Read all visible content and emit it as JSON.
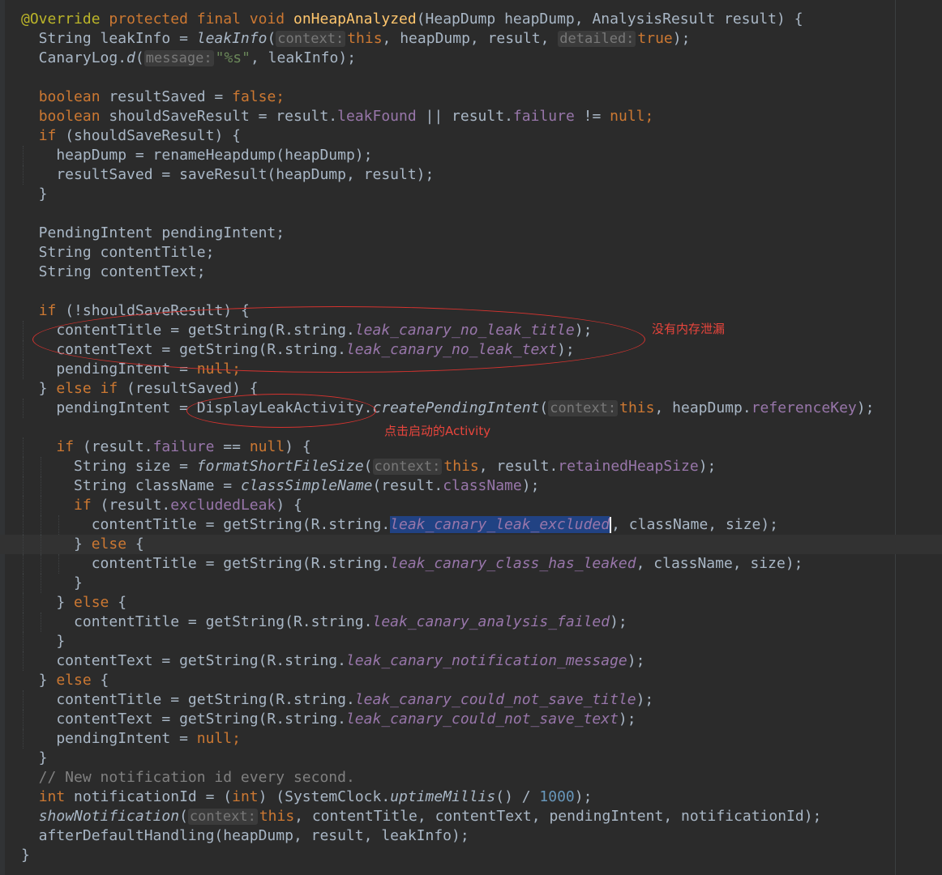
{
  "editor": {
    "colors": {
      "background": "#2b2b2b",
      "keyword": "#cc7832",
      "annotation": "#bbb529",
      "string": "#6a8759",
      "number": "#6897bb",
      "field": "#9876aa",
      "method_decl": "#ffc66d",
      "comment": "#808080",
      "text": "#a9b7c6",
      "selection": "#214283",
      "annotation_mark": "#d6332f"
    },
    "caret_line": 27,
    "lines": [
      [
        {
          "t": "@Override",
          "c": "ann"
        },
        {
          "t": " "
        },
        {
          "t": "protected final void",
          "c": "kw"
        },
        {
          "t": " "
        },
        {
          "t": "onHeapAnalyzed",
          "c": "meth"
        },
        {
          "t": "(HeapDump heapDump, AnalysisResult result) {"
        }
      ],
      [
        {
          "t": "  String leakInfo = "
        },
        {
          "t": "leakInfo",
          "c": "ital"
        },
        {
          "t": "("
        },
        {
          "t": "context:",
          "c": "hint"
        },
        {
          "t": "this",
          "c": "kw"
        },
        {
          "t": ", heapDump, result, "
        },
        {
          "t": "detailed:",
          "c": "hint"
        },
        {
          "t": "true",
          "c": "kw"
        },
        {
          "t": ");"
        }
      ],
      [
        {
          "t": "  CanaryLog."
        },
        {
          "t": "d",
          "c": "ital"
        },
        {
          "t": "("
        },
        {
          "t": "message:",
          "c": "hint"
        },
        {
          "t": "\"%s\"",
          "c": "str"
        },
        {
          "t": ", leakInfo);"
        }
      ],
      [],
      [
        {
          "t": "  "
        },
        {
          "t": "boolean",
          "c": "kw"
        },
        {
          "t": " resultSaved = "
        },
        {
          "t": "false",
          "c": "kw"
        },
        {
          "t": ";",
          "c": "kw"
        }
      ],
      [
        {
          "t": "  "
        },
        {
          "t": "boolean",
          "c": "kw"
        },
        {
          "t": " shouldSaveResult = result."
        },
        {
          "t": "leakFound",
          "c": "fld"
        },
        {
          "t": " || result."
        },
        {
          "t": "failure",
          "c": "fld"
        },
        {
          "t": " != "
        },
        {
          "t": "null",
          "c": "kw"
        },
        {
          "t": ";",
          "c": "kw"
        }
      ],
      [
        {
          "t": "  "
        },
        {
          "t": "if",
          "c": "kw"
        },
        {
          "t": " (shouldSaveResult) {"
        }
      ],
      [
        {
          "t": "    heapDump = renameHeapdump(heapDump);"
        }
      ],
      [
        {
          "t": "    resultSaved = saveResult(heapDump, result);"
        }
      ],
      [
        {
          "t": "  }"
        }
      ],
      [],
      [
        {
          "t": "  PendingIntent pendingIntent;"
        }
      ],
      [
        {
          "t": "  String contentTitle;"
        }
      ],
      [
        {
          "t": "  String contentText;"
        }
      ],
      [],
      [
        {
          "t": "  "
        },
        {
          "t": "if",
          "c": "kw"
        },
        {
          "t": " (!shouldSaveResult) {"
        }
      ],
      [
        {
          "t": "    contentTitle = getString(R.string."
        },
        {
          "t": "leak_canary_no_leak_title",
          "c": "ifld"
        },
        {
          "t": ");"
        }
      ],
      [
        {
          "t": "    contentText = getString(R.string."
        },
        {
          "t": "leak_canary_no_leak_text",
          "c": "ifld"
        },
        {
          "t": ");"
        }
      ],
      [
        {
          "t": "    pendingIntent = "
        },
        {
          "t": "null",
          "c": "kw"
        },
        {
          "t": ";",
          "c": "kw"
        }
      ],
      [
        {
          "t": "  } "
        },
        {
          "t": "else if",
          "c": "kw"
        },
        {
          "t": " (resultSaved) {"
        }
      ],
      [
        {
          "t": "    pendingIntent = DisplayLeakActivity."
        },
        {
          "t": "createPendingIntent",
          "c": "ital"
        },
        {
          "t": "("
        },
        {
          "t": "context:",
          "c": "hint"
        },
        {
          "t": "this",
          "c": "kw"
        },
        {
          "t": ", heapDump."
        },
        {
          "t": "referenceKey",
          "c": "fld"
        },
        {
          "t": ");"
        }
      ],
      [],
      [
        {
          "t": "    "
        },
        {
          "t": "if",
          "c": "kw"
        },
        {
          "t": " (result."
        },
        {
          "t": "failure",
          "c": "fld"
        },
        {
          "t": " == "
        },
        {
          "t": "null",
          "c": "kw"
        },
        {
          "t": ") {"
        }
      ],
      [
        {
          "t": "      String size = "
        },
        {
          "t": "formatShortFileSize",
          "c": "ital"
        },
        {
          "t": "("
        },
        {
          "t": "context:",
          "c": "hint"
        },
        {
          "t": "this",
          "c": "kw"
        },
        {
          "t": ", result."
        },
        {
          "t": "retainedHeapSize",
          "c": "fld"
        },
        {
          "t": ");"
        }
      ],
      [
        {
          "t": "      String className = "
        },
        {
          "t": "classSimpleName",
          "c": "ital"
        },
        {
          "t": "(result."
        },
        {
          "t": "className",
          "c": "fld"
        },
        {
          "t": ");"
        }
      ],
      [
        {
          "t": "      "
        },
        {
          "t": "if",
          "c": "kw"
        },
        {
          "t": " (result."
        },
        {
          "t": "excludedLeak",
          "c": "fld"
        },
        {
          "t": ") {"
        }
      ],
      [
        {
          "t": "        contentTitle = getString(R.string."
        },
        {
          "t": "leak_canary_leak_excluded",
          "c": "ifld sel"
        },
        {
          "t": "",
          "c": "caret"
        },
        {
          "t": ", className, size);"
        }
      ],
      [
        {
          "t": "      } "
        },
        {
          "t": "else",
          "c": "kw"
        },
        {
          "t": " {"
        }
      ],
      [
        {
          "t": "        contentTitle = getString(R.string."
        },
        {
          "t": "leak_canary_class_has_leaked",
          "c": "ifld"
        },
        {
          "t": ", className, size);"
        }
      ],
      [
        {
          "t": "      }"
        }
      ],
      [
        {
          "t": "    } "
        },
        {
          "t": "else",
          "c": "kw"
        },
        {
          "t": " {"
        }
      ],
      [
        {
          "t": "      contentTitle = getString(R.string."
        },
        {
          "t": "leak_canary_analysis_failed",
          "c": "ifld"
        },
        {
          "t": ");"
        }
      ],
      [
        {
          "t": "    }"
        }
      ],
      [
        {
          "t": "    contentText = getString(R.string."
        },
        {
          "t": "leak_canary_notification_message",
          "c": "ifld"
        },
        {
          "t": ");"
        }
      ],
      [
        {
          "t": "  } "
        },
        {
          "t": "else",
          "c": "kw"
        },
        {
          "t": " {"
        }
      ],
      [
        {
          "t": "    contentTitle = getString(R.string."
        },
        {
          "t": "leak_canary_could_not_save_title",
          "c": "ifld"
        },
        {
          "t": ");"
        }
      ],
      [
        {
          "t": "    contentText = getString(R.string."
        },
        {
          "t": "leak_canary_could_not_save_text",
          "c": "ifld"
        },
        {
          "t": ");"
        }
      ],
      [
        {
          "t": "    pendingIntent = "
        },
        {
          "t": "null",
          "c": "kw"
        },
        {
          "t": ";",
          "c": "kw"
        }
      ],
      [
        {
          "t": "  }"
        }
      ],
      [
        {
          "t": "  // New notification id every second.",
          "c": "cmt"
        }
      ],
      [
        {
          "t": "  "
        },
        {
          "t": "int",
          "c": "kw"
        },
        {
          "t": " notificationId = ("
        },
        {
          "t": "int",
          "c": "kw"
        },
        {
          "t": ") (SystemClock."
        },
        {
          "t": "uptimeMillis",
          "c": "ital"
        },
        {
          "t": "() / "
        },
        {
          "t": "1000",
          "c": "num"
        },
        {
          "t": ");"
        }
      ],
      [
        {
          "t": "  "
        },
        {
          "t": "showNotification",
          "c": "ital"
        },
        {
          "t": "("
        },
        {
          "t": "context:",
          "c": "hint"
        },
        {
          "t": "this",
          "c": "kw"
        },
        {
          "t": ", contentTitle, contentText, pendingIntent, notificationId);"
        }
      ],
      [
        {
          "t": "  afterDefaultHandling(heapDump, result, leakInfo);"
        }
      ],
      [
        {
          "t": "}"
        }
      ]
    ]
  },
  "annotations": {
    "no_leak_note": "没有内存泄漏",
    "activity_note": "点击启动的Activity"
  }
}
